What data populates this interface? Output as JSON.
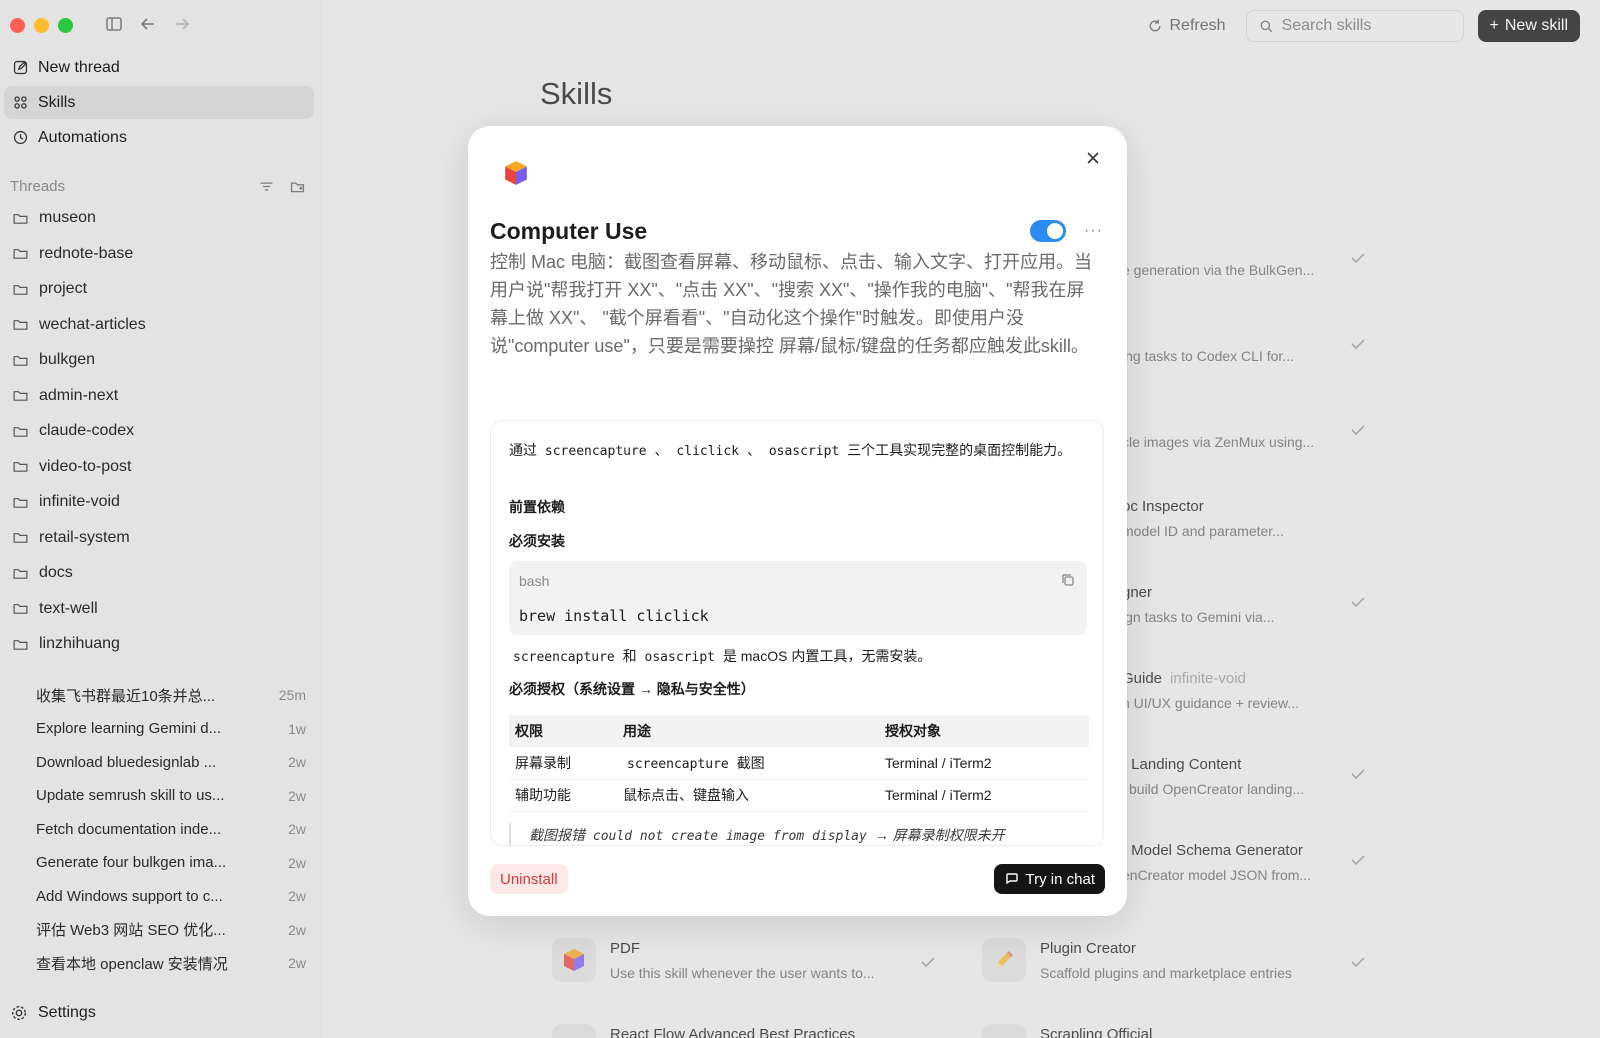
{
  "sidebar": {
    "nav": [
      {
        "label": "New thread",
        "icon": "edit-icon"
      },
      {
        "label": "Skills",
        "icon": "grid-icon"
      },
      {
        "label": "Automations",
        "icon": "clock-icon"
      }
    ],
    "threads_title": "Threads",
    "folders": [
      "museon",
      "rednote-base",
      "project",
      "wechat-articles",
      "bulkgen",
      "admin-next",
      "claude-codex",
      "video-to-post",
      "infinite-void",
      "retail-system",
      "docs",
      "text-well",
      "linzhihuang"
    ],
    "threads": [
      {
        "title": "收集飞书群最近10条并总...",
        "time": "25m"
      },
      {
        "title": "Explore learning Gemini d...",
        "time": "1w"
      },
      {
        "title": "Download bluedesignlab ...",
        "time": "2w"
      },
      {
        "title": "Update semrush skill to us...",
        "time": "2w"
      },
      {
        "title": "Fetch documentation inde...",
        "time": "2w"
      },
      {
        "title": "Generate four bulkgen ima...",
        "time": "2w"
      },
      {
        "title": "Add Windows support to c...",
        "time": "2w"
      },
      {
        "title": "评估 Web3 网站 SEO 优化...",
        "time": "2w"
      },
      {
        "title": "查看本地 openclaw 安装情况",
        "time": "2w"
      }
    ],
    "settings_label": "Settings"
  },
  "topbar": {
    "refresh_label": "Refresh",
    "search_placeholder": "Search skills",
    "new_skill_label": "New skill"
  },
  "main": {
    "title": "Skills",
    "peek_cards": [
      {
        "name": "",
        "desc": "e generation via the BulkGen...",
        "tag": ""
      },
      {
        "name": "",
        "desc": "ing tasks to Codex CLI for...",
        "tag": ""
      },
      {
        "name": "",
        "desc": "cle images via ZenMux using...",
        "tag": ""
      },
      {
        "name": "oc Inspector",
        "desc": "model ID and parameter...",
        "tag": ""
      },
      {
        "name": "gner",
        "desc": "ign tasks to Gemini via...",
        "tag": ""
      },
      {
        "name": "Guide",
        "desc": "n UI/UX guidance + review...",
        "tag": "infinite-void"
      },
      {
        "name": "r Landing Content",
        "desc": "l build OpenCreator landing...",
        "tag": ""
      },
      {
        "name": "r Model Schema Generator",
        "desc": "enCreator model JSON from...",
        "tag": ""
      }
    ],
    "cards": [
      {
        "name": "PDF",
        "desc": "Use this skill whenever the user wants to..."
      },
      {
        "name": "Plugin Creator",
        "desc": "Scaffold plugins and marketplace entries"
      },
      {
        "name": "React Flow Advanced Best Practices",
        "desc": ""
      },
      {
        "name": "Scrapling Official",
        "desc": ""
      }
    ]
  },
  "modal": {
    "title": "Computer Use",
    "enabled": true,
    "more_label": "···",
    "description": "控制 Mac 电脑：截图查看屏幕、移动鼠标、点击、输入文字、打开应用。当用户说\"帮我打开 XX\"、\"点击 XX\"、\"搜索 XX\"、\"操作我的电脑\"、\"帮我在屏幕上做 XX\"、 \"截个屏看看\"、\"自动化这个操作\"时触发。即使用户没说\"computer use\"，只要是需要操控 屏幕/鼠标/键盘的任务都应触发此skill。",
    "doc": {
      "intro_prefix": "通过",
      "tool1": "screencapture",
      "sep1": "、",
      "tool2": "cliclick",
      "sep2": "、",
      "tool3": "osascript",
      "intro_suffix": "三个工具实现完整的桌面控制能力。",
      "h_prereq": "前置依赖",
      "h_install": "必须安装",
      "code_lang": "bash",
      "code_cmd": "brew install cliclick",
      "builtin_tool1": "screencapture",
      "builtin_and": "和",
      "builtin_tool2": "osascript",
      "builtin_suffix": "是 macOS 内置工具，无需安装。",
      "h_auth": "必须授权（系统设置 → 隐私与安全性）",
      "table_headers": [
        "权限",
        "用途",
        "授权对象"
      ],
      "table_rows": [
        {
          "perm": "屏幕录制",
          "use_code": "screencapture",
          "use_text": "截图",
          "target": "Terminal / iTerm2"
        },
        {
          "perm": "辅助功能",
          "use_code": "",
          "use_text": "鼠标点击、键盘输入",
          "target": "Terminal / iTerm2"
        }
      ],
      "quote_prefix": "截图报错",
      "quote_code": "could not create image from display",
      "quote_suffix": "→ 屏幕录制权限未开"
    },
    "uninstall_label": "Uninstall",
    "try_label": "Try in chat"
  },
  "colors": {
    "accent": "#2d8cf0",
    "danger": "#d33b3b",
    "traffic_red": "#ff5f57",
    "traffic_yellow": "#febc2e",
    "traffic_green": "#28c840"
  }
}
